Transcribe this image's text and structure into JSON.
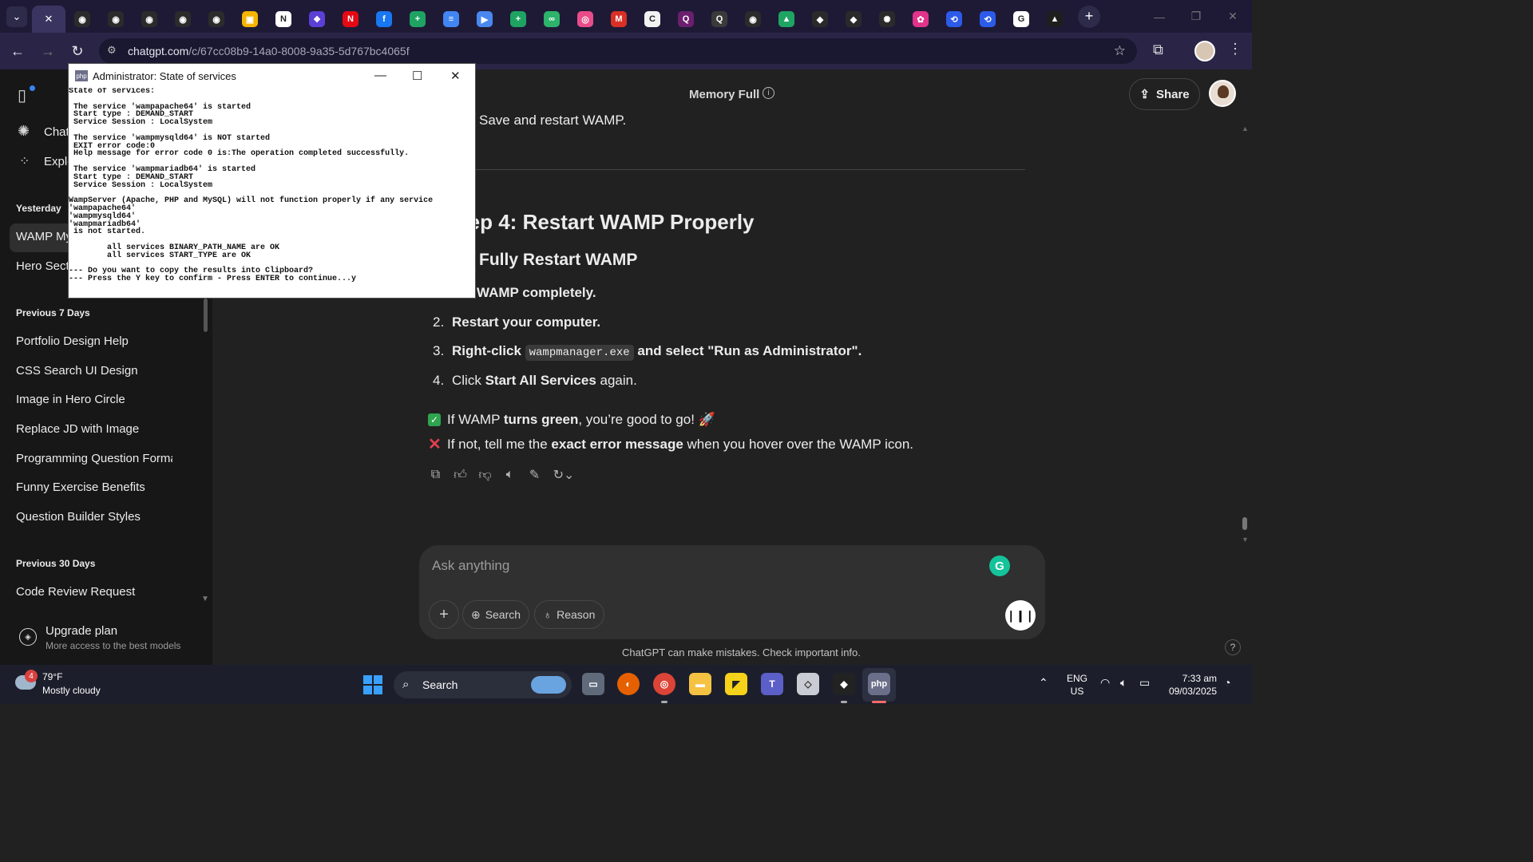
{
  "browser": {
    "tabs": [
      {
        "name": "active-tab",
        "glyph": "✕",
        "color": "#3a3560"
      },
      {
        "name": "tab-github-1",
        "glyph": "◉",
        "color": "#2b2b2b"
      },
      {
        "name": "tab-github-2",
        "glyph": "◉",
        "color": "#2b2b2b"
      },
      {
        "name": "tab-github-3",
        "glyph": "◉",
        "color": "#2b2b2b"
      },
      {
        "name": "tab-github-4",
        "glyph": "◉",
        "color": "#2b2b2b"
      },
      {
        "name": "tab-github-5",
        "glyph": "◉",
        "color": "#2b2b2b"
      },
      {
        "name": "tab-classroom",
        "glyph": "▣",
        "color": "#f4b400"
      },
      {
        "name": "tab-notion",
        "glyph": "N",
        "color": "#ffffff"
      },
      {
        "name": "tab-app-purple",
        "glyph": "❖",
        "color": "#5b3fd6"
      },
      {
        "name": "tab-netflix",
        "glyph": "N",
        "color": "#e50914"
      },
      {
        "name": "tab-facebook",
        "glyph": "f",
        "color": "#1877f2"
      },
      {
        "name": "tab-sheets-1",
        "glyph": "+",
        "color": "#1ea362"
      },
      {
        "name": "tab-docs",
        "glyph": "≡",
        "color": "#4285f4"
      },
      {
        "name": "tab-meet",
        "glyph": "▶",
        "color": "#4a88f0"
      },
      {
        "name": "tab-sheets-2",
        "glyph": "+",
        "color": "#1ea362"
      },
      {
        "name": "tab-green-app",
        "glyph": "∞",
        "color": "#2db36b"
      },
      {
        "name": "tab-dribbble",
        "glyph": "◎",
        "color": "#ea4c89"
      },
      {
        "name": "tab-gmail",
        "glyph": "M",
        "color": "#d93025"
      },
      {
        "name": "tab-coda",
        "glyph": "C",
        "color": "#f2f2f2"
      },
      {
        "name": "tab-q-1",
        "glyph": "Q",
        "color": "#6b1f6e"
      },
      {
        "name": "tab-q-2",
        "glyph": "Q",
        "color": "#3a3a3a"
      },
      {
        "name": "tab-github-6",
        "glyph": "◉",
        "color": "#2b2b2b"
      },
      {
        "name": "tab-drive",
        "glyph": "▲",
        "color": "#1fa463"
      },
      {
        "name": "tab-cube-1",
        "glyph": "◆",
        "color": "#2a2a2a"
      },
      {
        "name": "tab-cube-2",
        "glyph": "◆",
        "color": "#2a2a2a"
      },
      {
        "name": "tab-openai",
        "glyph": "✺",
        "color": "#2a2a2a"
      },
      {
        "name": "tab-pink-app",
        "glyph": "✿",
        "color": "#e0338a"
      },
      {
        "name": "tab-link-1",
        "glyph": "⟲",
        "color": "#2c5bea"
      },
      {
        "name": "tab-link-2",
        "glyph": "⟲",
        "color": "#2c5bea"
      },
      {
        "name": "tab-google",
        "glyph": "G",
        "color": "#ffffff"
      },
      {
        "name": "tab-artstation",
        "glyph": "▲",
        "color": "#1e1e1e"
      }
    ],
    "url_host": "chatgpt.com",
    "url_path": "/c/67cc08b9-14a0-8008-9a35-5d767bc4065f"
  },
  "sidebar": {
    "top_items": [
      "Chat",
      "Explo"
    ],
    "sections": [
      {
        "heading": "Yesterday",
        "items": [
          "WAMP My",
          "Hero Secti"
        ]
      },
      {
        "heading": "Previous 7 Days",
        "items": [
          "Portfolio Design Help",
          "CSS Search UI Design",
          "Image in Hero Circle",
          "Replace JD with Image",
          "Programming Question Forma",
          "Funny Exercise Benefits",
          "Question Builder Styles"
        ]
      },
      {
        "heading": "Previous 30 Days",
        "items": [
          "Code Review Request"
        ]
      }
    ],
    "upgrade_title": "Upgrade plan",
    "upgrade_subtitle": "More access to the best models"
  },
  "header": {
    "memory": "Memory Full",
    "share": "Share"
  },
  "content": {
    "partial_line": "Save and restart WAMP.",
    "heading": "tep 4: Restart WAMP Properly",
    "subheading": "Fully Restart WAMP",
    "steps": [
      {
        "num": "",
        "before": "",
        "bold": "WAMP completely.",
        "code": "",
        "after": ""
      },
      {
        "num": "2.",
        "before": "",
        "bold": "Restart your computer.",
        "code": "",
        "after": ""
      },
      {
        "num": "3.",
        "before": "",
        "bold": "Right-click ",
        "code": "wampmanager.exe",
        "after": " and select \"Run as Administrator\"."
      },
      {
        "num": "4.",
        "before": "Click ",
        "bold": "Start All Services",
        "code": "",
        "after": " again."
      }
    ],
    "note_ok_pre": "If WAMP ",
    "note_ok_bold": "turns green",
    "note_ok_post": ", you’re good to go! 🚀",
    "note_err_pre": "If not, tell me the ",
    "note_err_bold": "exact error message",
    "note_err_post": " when you hover over the WAMP icon."
  },
  "composer": {
    "placeholder": "Ask anything",
    "search": "Search",
    "reason": "Reason",
    "disclaimer": "ChatGPT can make mistakes. Check important info."
  },
  "console": {
    "title": "Administrator:  State of services",
    "icon_text": "php",
    "text": "State of services:\n\n The service 'wampapache64' is started\n Start type : DEMAND_START\n Service Session : LocalSystem\n\n The service 'wampmysqld64' is NOT started\n EXIT error code:0\n Help message for error code 0 is:The operation completed successfully.\n\n The service 'wampmariadb64' is started\n Start type : DEMAND_START\n Service Session : LocalSystem\n\nWampServer (Apache, PHP and MySQL) will not function properly if any service\n'wampapache64'\n'wampmysqld64'\n'wampmariadb64'\n is not started.\n\n        all services BINARY_PATH_NAME are OK\n        all services START_TYPE are OK\n\n--- Do you want to copy the results into Clipboard?\n--- Press the Y key to confirm - Press ENTER to continue...y"
  },
  "taskbar": {
    "weather_badge": "4",
    "temperature": "79°F",
    "condition": "Mostly cloudy",
    "search": "Search",
    "lang1": "ENG",
    "lang2": "US",
    "time": "7:33 am",
    "date": "09/03/2025"
  }
}
